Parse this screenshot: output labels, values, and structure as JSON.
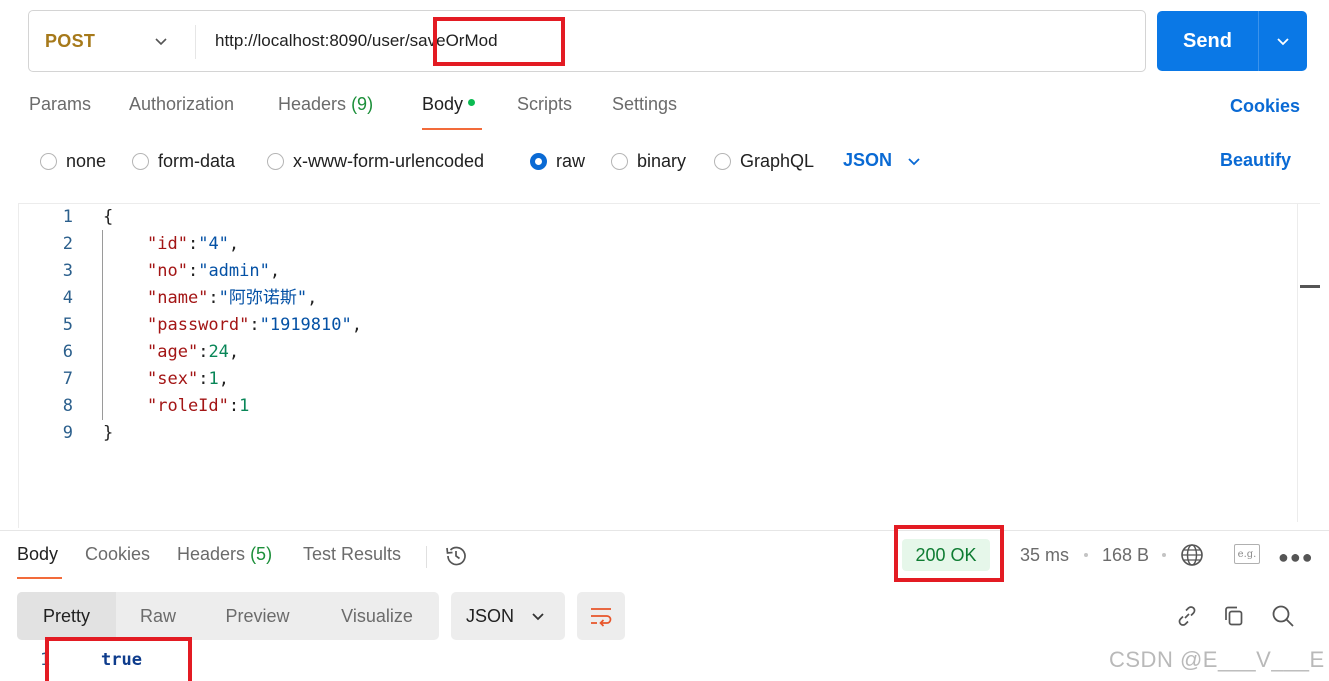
{
  "request": {
    "method": "POST",
    "url": "http://localhost:8090/user/saveOrMod",
    "send_label": "Send"
  },
  "request_tabs": {
    "params": "Params",
    "authorization": "Authorization",
    "headers": "Headers",
    "headers_count": "(9)",
    "body": "Body",
    "scripts": "Scripts",
    "settings": "Settings",
    "cookies": "Cookies"
  },
  "body_types": {
    "none": "none",
    "form_data": "form-data",
    "urlencoded": "x-www-form-urlencoded",
    "raw": "raw",
    "binary": "binary",
    "graphql": "GraphQL",
    "selected": "raw",
    "format": "JSON",
    "beautify": "Beautify"
  },
  "editor": {
    "line_numbers": [
      "1",
      "2",
      "3",
      "4",
      "5",
      "6",
      "7",
      "8",
      "9"
    ],
    "lines": {
      "l1": "{",
      "l2_key": "\"id\"",
      "l2_val": "\"4\"",
      "l3_key": "\"no\"",
      "l3_val": "\"admin\"",
      "l4_key": "\"name\"",
      "l4_val": "\"阿弥诺斯\"",
      "l5_key": "\"password\"",
      "l5_val": "\"1919810\"",
      "l6_key": "\"age\"",
      "l6_val": "24",
      "l7_key": "\"sex\"",
      "l7_val": "1",
      "l8_key": "\"roleId\"",
      "l8_val": "1",
      "l9": "}"
    }
  },
  "response": {
    "tabs": {
      "body": "Body",
      "cookies": "Cookies",
      "headers": "Headers",
      "headers_count": "(5)",
      "test_results": "Test Results"
    },
    "status": "200 OK",
    "time": "35 ms",
    "size": "168 B",
    "example_icon_text": "e.g.",
    "views": {
      "pretty": "Pretty",
      "raw": "Raw",
      "preview": "Preview",
      "visualize": "Visualize"
    },
    "format": "JSON",
    "line_number": "1",
    "value": "true"
  },
  "watermark": "CSDN @E___V___E",
  "colors": {
    "accent": "#0a78e6",
    "method": "#a6791a",
    "highlight_box": "#e31b23",
    "status_ok": "#0e7c32"
  }
}
